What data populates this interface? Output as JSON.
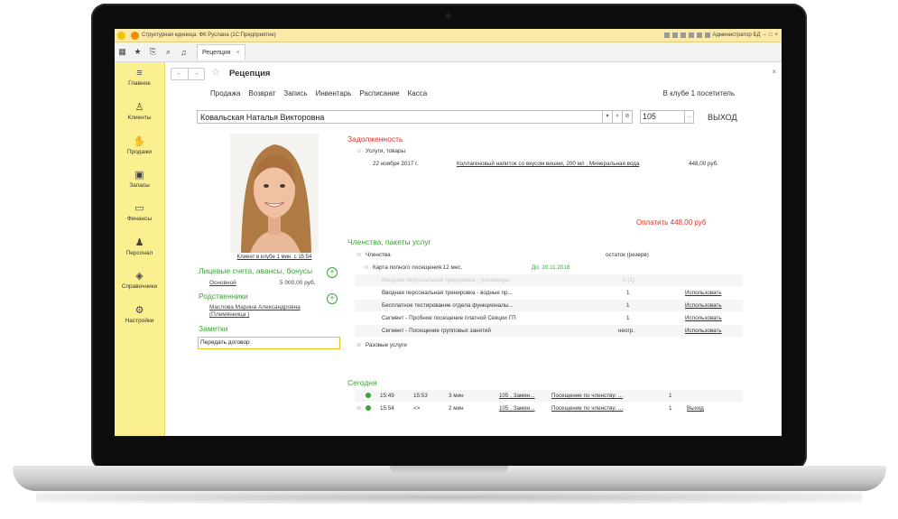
{
  "titlebar": {
    "text": "Структурная единица: ФК Руслана  (1С:Предприятие)",
    "user": "Администратор БД"
  },
  "tab": {
    "label": "Рецепция"
  },
  "sidebar": {
    "items": [
      {
        "label": "Главное",
        "icon": "hamburger-icon"
      },
      {
        "label": "Клиенты",
        "icon": "user-icon"
      },
      {
        "label": "Продажи",
        "icon": "sales-icon"
      },
      {
        "label": "Запасы",
        "icon": "box-icon"
      },
      {
        "label": "Финансы",
        "icon": "wallet-icon"
      },
      {
        "label": "Персонал",
        "icon": "staff-icon"
      },
      {
        "label": "Справочники",
        "icon": "books-icon"
      },
      {
        "label": "Настройки",
        "icon": "gear-icon"
      }
    ]
  },
  "page": {
    "title": "Рецепция",
    "visitors": "В клубе 1 посетитель"
  },
  "menu": [
    "Продажа",
    "Возврат",
    "Запись",
    "Инвентарь",
    "Расписание",
    "Касса"
  ],
  "client": {
    "name": "Ковальская Наталья Викторовна",
    "card": "105",
    "exit": "ВЫХОД",
    "in_club": "Клиент в клубе 1 мин. с 15:54"
  },
  "accounts": {
    "title": "Лицевые счета, авансы, бонусы",
    "name": "Основной",
    "amount": "5 000,00 руб."
  },
  "relatives": {
    "title": "Родственники",
    "line1": "Маслова Марина Александровна",
    "line2": "(Племянница )"
  },
  "notes": {
    "title": "Заметки",
    "value": "Передать договор"
  },
  "debt": {
    "title": "Задолженность",
    "group": "Услуги, товары",
    "date": "22 ноября 2017 г.",
    "item": "Коллагеновый напиток со вкусом вишни, 200 мл , Минеральная вода",
    "amount": "448,00 руб.",
    "pay": "Оплатить 448,00 руб"
  },
  "memberships": {
    "title": "Членства, пакеты услуг",
    "group": "Членства",
    "group_col": "остаток (резерв)",
    "card": "Карта полного посещения 12 мес.",
    "card_until": "До: 20.11.2018",
    "rows": [
      {
        "name": "Вводная персональная тренировка - тренажеры",
        "qty": "0 (1)",
        "action": ""
      },
      {
        "name": "Вводная персональная тренировка - водные пр...",
        "qty": "1",
        "action": "Использовать"
      },
      {
        "name": "Бесплатное тестирование отдела функционалы...",
        "qty": "1",
        "action": "Использовать"
      },
      {
        "name": "Сегмент - Пробное посещение платной Секции ГП",
        "qty": "1",
        "action": "Использовать"
      },
      {
        "name": "Сегмент - Посещение групповых занятий",
        "qty": "неогр.",
        "action": "Использовать"
      }
    ],
    "single": "Разовые услуги"
  },
  "today": {
    "title": "Сегодня",
    "rows": [
      {
        "in": "15:49",
        "out": "15:53",
        "dur": "3 мин",
        "key": "105 , Замен...",
        "svc": "Посещение по членству: ...",
        "count": "1",
        "action": ""
      },
      {
        "in": "15:54",
        "out": "<>",
        "dur": "2 мин",
        "key": "105 , Замен...",
        "svc": "Посещение по членству: ...",
        "count": "1",
        "action": "Выход"
      }
    ]
  },
  "colors": {
    "accent": "#3aa535",
    "danger": "#e0322a",
    "sidebar": "#fbf090"
  }
}
